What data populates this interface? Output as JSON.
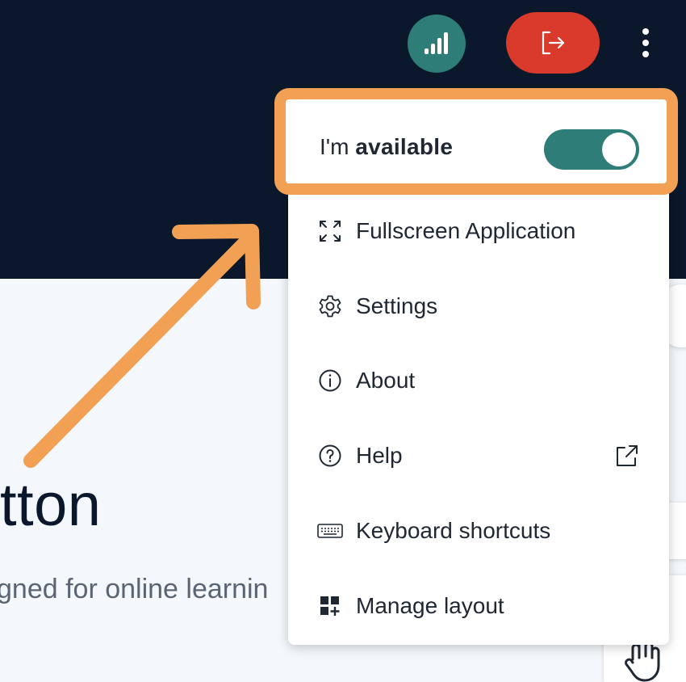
{
  "background": {
    "title_fragment": "tton",
    "subtitle_fragment": "gned for online learnin"
  },
  "header": {
    "connection_icon": "signal-bars-icon",
    "leave_icon": "leave-session-icon",
    "menu_icon": "kebab-menu-icon"
  },
  "menu": {
    "availability": {
      "prefix": "I'm ",
      "status": "available",
      "toggle_on": true
    },
    "items": [
      {
        "label": "Fullscreen Application",
        "icon": "fullscreen-icon"
      },
      {
        "label": "Settings",
        "icon": "gear-icon"
      },
      {
        "label": "About",
        "icon": "info-icon"
      },
      {
        "label": "Help",
        "icon": "help-icon",
        "trailing_icon": "external-link-icon"
      },
      {
        "label": "Keyboard shortcuts",
        "icon": "keyboard-icon"
      },
      {
        "label": "Manage layout",
        "icon": "layout-icon"
      }
    ]
  },
  "colors": {
    "header_bg": "#0b172a",
    "accent_teal": "#2e7d78",
    "leave_red": "#d93a2b",
    "highlight_orange": "#f2a154"
  }
}
